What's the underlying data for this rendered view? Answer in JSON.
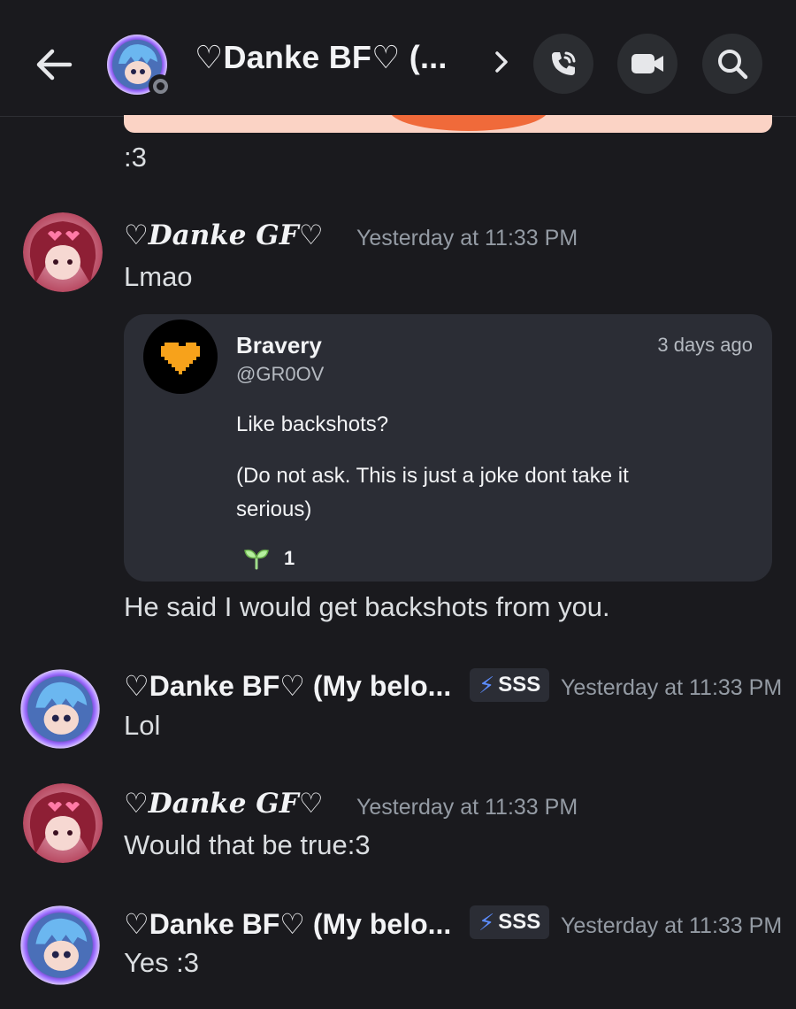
{
  "header": {
    "title": "♡Danke BF♡ (...",
    "back_icon": "arrow-left-icon",
    "chevron_icon": "chevron-right-icon",
    "call_icon": "phone-call-icon",
    "video_icon": "video-camera-icon",
    "search_icon": "search-icon",
    "avatar_status": "idle-offline"
  },
  "messages": {
    "prev_tail": ":3",
    "m1": {
      "username": "♡Danke GF♡",
      "timestamp": "Yesterday at 11:33 PM",
      "text": "Lmao",
      "embed": {
        "name": "Bravery",
        "handle": "@GR0OV",
        "time": "3 days ago",
        "line1": "Like backshots?",
        "line2a": "(Do not ask. This is just a joke dont take it",
        "line2b": "serious)",
        "likes": "1",
        "avatar_icon": "orange-heart-icon",
        "like_icon": "sprout-icon"
      },
      "after": "He said I would get backshots from you."
    },
    "m2": {
      "username": "♡Danke BF♡ (My belo...",
      "tag": "SSS",
      "timestamp": "Yesterday at 11:33 PM",
      "text": "Lol"
    },
    "m3": {
      "username": "♡Danke GF♡",
      "timestamp": "Yesterday at 11:33 PM",
      "text": "Would that be true:3"
    },
    "m4": {
      "username": "♡Danke BF♡ (My belo...",
      "tag": "SSS",
      "timestamp": "Yesterday at 11:33 PM",
      "text": "Yes :3"
    }
  },
  "colors": {
    "background": "#1a1a1e",
    "embed_bg": "#2b2d35",
    "heart_orange": "#f7a21b",
    "bolt_blue": "#5c8dff",
    "avatar_glow": "#8e5bff"
  }
}
